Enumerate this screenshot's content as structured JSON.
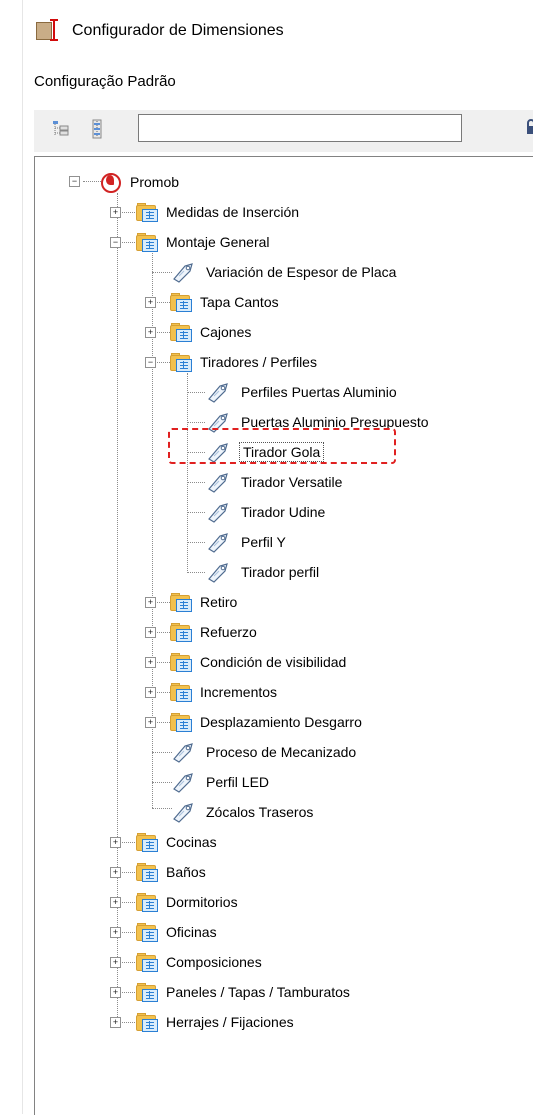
{
  "window": {
    "title": "Configurador de Dimensiones"
  },
  "config_label": "Configuração Padrão",
  "toolbar": {
    "search_value": "",
    "search_placeholder": ""
  },
  "tree": {
    "root": "Promob",
    "medidas": "Medidas de Inserción",
    "montaje": "Montaje General",
    "variacion": "Variación de Espesor de Placa",
    "tapa": "Tapa Cantos",
    "cajones": "Cajones",
    "tiradores": "Tiradores / Perfiles",
    "perfiles_puertas": "Perfiles Puertas Aluminio",
    "puertas_presupuesto": "Puertas Aluminio Presupuesto",
    "tirador_gola": "Tirador Gola",
    "tirador_versatile": "Tirador Versatile",
    "tirador_udine": "Tirador Udine",
    "perfil_y": "Perfil Y",
    "tirador_perfil": "Tirador perfil",
    "retiro": "Retiro",
    "refuerzo": "Refuerzo",
    "condicion": "Condición de visibilidad",
    "incrementos": "Incrementos",
    "desplazamiento": "Desplazamiento Desgarro",
    "proceso": "Proceso de Mecanizado",
    "perfil_led": "Perfil LED",
    "zocalos": "Zócalos Traseros",
    "cocinas": "Cocinas",
    "banos": "Baños",
    "dormitorios": "Dormitorios",
    "oficinas": "Oficinas",
    "composiciones": "Composiciones",
    "paneles": "Paneles / Tapas / Tamburatos",
    "herrajes": "Herrajes / Fijaciones"
  },
  "expander_glyphs": {
    "collapsed": "+",
    "expanded": "−"
  },
  "icons": {
    "app": "dimension-configurator-icon",
    "collapse_tree": "tree-collapse-icon",
    "expand_tree": "tree-expand-icon",
    "folder": "folder-table-icon",
    "item": "tag-icon",
    "root": "promob-logo-icon",
    "lock": "lock-icon"
  },
  "colors": {
    "highlight": "#e02020",
    "folder": "#f2c14e",
    "sheet": "#2a7fd4",
    "promob": "#d12323"
  }
}
